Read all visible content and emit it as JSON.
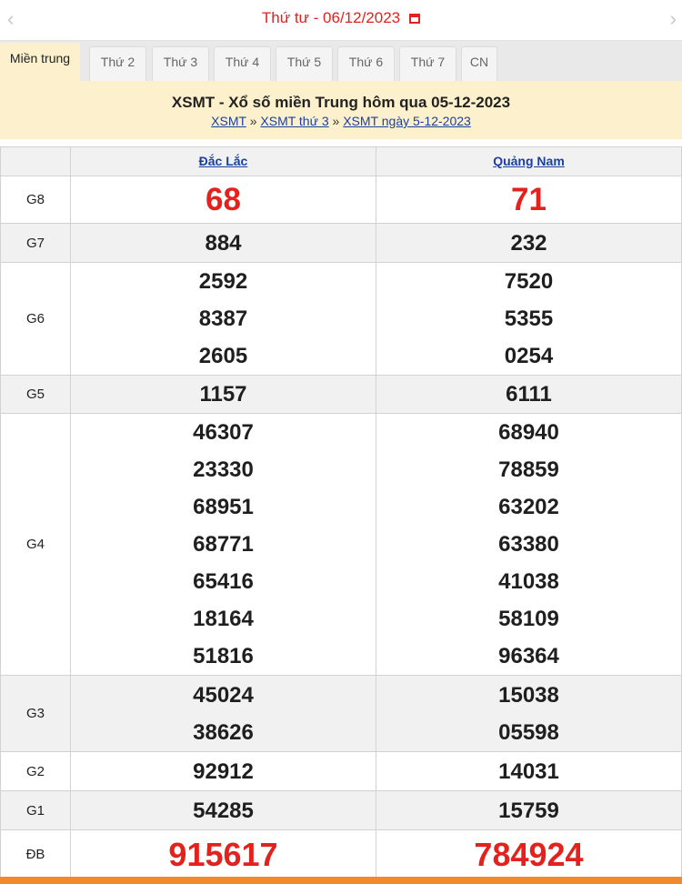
{
  "datebar": {
    "prev_icon": "chevron-left",
    "next_icon": "chevron-right",
    "date_label": "Thứ tư -  06/12/2023",
    "calendar_icon": "calendar-icon"
  },
  "tabs": [
    {
      "label": "Miền trung",
      "active": true
    },
    {
      "label": "Thứ 2"
    },
    {
      "label": "Thứ 3"
    },
    {
      "label": "Thứ 4"
    },
    {
      "label": "Thứ 5"
    },
    {
      "label": "Thứ 6"
    },
    {
      "label": "Thứ 7"
    },
    {
      "label": "CN"
    }
  ],
  "banner": {
    "title": "XSMT - Xổ số miền Trung hôm qua 05-12-2023",
    "crumbs": [
      "XSMT",
      "XSMT thứ 3",
      "XSMT ngày 5-12-2023"
    ],
    "separator": "»"
  },
  "provinces": [
    "Đắc Lắc",
    "Quảng Nam"
  ],
  "prizes": [
    {
      "name": "G8",
      "values": [
        [
          "68"
        ],
        [
          "71"
        ]
      ]
    },
    {
      "name": "G7",
      "values": [
        [
          "884"
        ],
        [
          "232"
        ]
      ]
    },
    {
      "name": "G6",
      "values": [
        [
          "2592",
          "8387",
          "2605"
        ],
        [
          "7520",
          "5355",
          "0254"
        ]
      ]
    },
    {
      "name": "G5",
      "values": [
        [
          "1157"
        ],
        [
          "6111"
        ]
      ]
    },
    {
      "name": "G4",
      "values": [
        [
          "46307",
          "23330",
          "68951",
          "68771",
          "65416",
          "18164",
          "51816"
        ],
        [
          "68940",
          "78859",
          "63202",
          "63380",
          "41038",
          "58109",
          "96364"
        ]
      ]
    },
    {
      "name": "G3",
      "values": [
        [
          "45024",
          "38626"
        ],
        [
          "15038",
          "05598"
        ]
      ]
    },
    {
      "name": "G2",
      "values": [
        [
          "92912"
        ],
        [
          "14031"
        ]
      ]
    },
    {
      "name": "G1",
      "values": [
        [
          "54285"
        ],
        [
          "15759"
        ]
      ]
    },
    {
      "name": "ĐB",
      "values": [
        [
          "915617"
        ],
        [
          "784924"
        ]
      ]
    }
  ],
  "colors": {
    "accent_red": "#e3211d",
    "banner_bg": "#fcf1cc",
    "link_blue": "#1d3fa0"
  }
}
